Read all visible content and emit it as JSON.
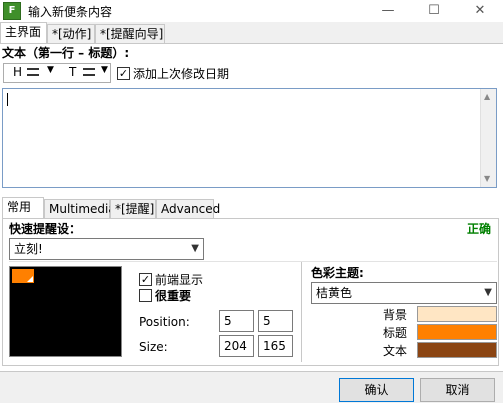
{
  "window": {
    "title": "输入新便条内容",
    "minimize": "—",
    "maximize": "☐",
    "close": "✕"
  },
  "top_tabs": [
    {
      "label": "主界面"
    },
    {
      "label": "*[动作]"
    },
    {
      "label": "*[提醒向导]"
    }
  ],
  "text_section": {
    "label": "文本（第一行 – 标题）:",
    "heading_btn": "H",
    "text_btn": "T",
    "add_date_checkbox": {
      "label": "添加上次修改日期",
      "checked": true
    },
    "editor_value": ""
  },
  "bottom_tabs": [
    {
      "label": "常用"
    },
    {
      "label": "Multimedia"
    },
    {
      "label": "*[提醒]"
    },
    {
      "label": "Advanced"
    }
  ],
  "quick_reminder": {
    "label": "快速提醒设：",
    "status": "正确",
    "selected": "立刻!"
  },
  "options": {
    "topmost": {
      "label": "前端显示",
      "checked": true
    },
    "important": {
      "label": "很重要",
      "checked": false
    },
    "position_label": "Position:",
    "position_x": "5",
    "position_y": "5",
    "size_label": "Size:",
    "size_w": "204",
    "size_h": "165"
  },
  "color_theme": {
    "label": "色彩主题:",
    "selected": "桔黄色",
    "rows": [
      {
        "label": "背景",
        "color": "#ffe6c4"
      },
      {
        "label": "标题",
        "color": "#ff8000"
      },
      {
        "label": "文本",
        "color": "#8b4513"
      }
    ]
  },
  "buttons": {
    "ok": "确认",
    "cancel": "取消"
  },
  "colors": {
    "preview_bg": "#000000",
    "status_green": "#008000"
  }
}
